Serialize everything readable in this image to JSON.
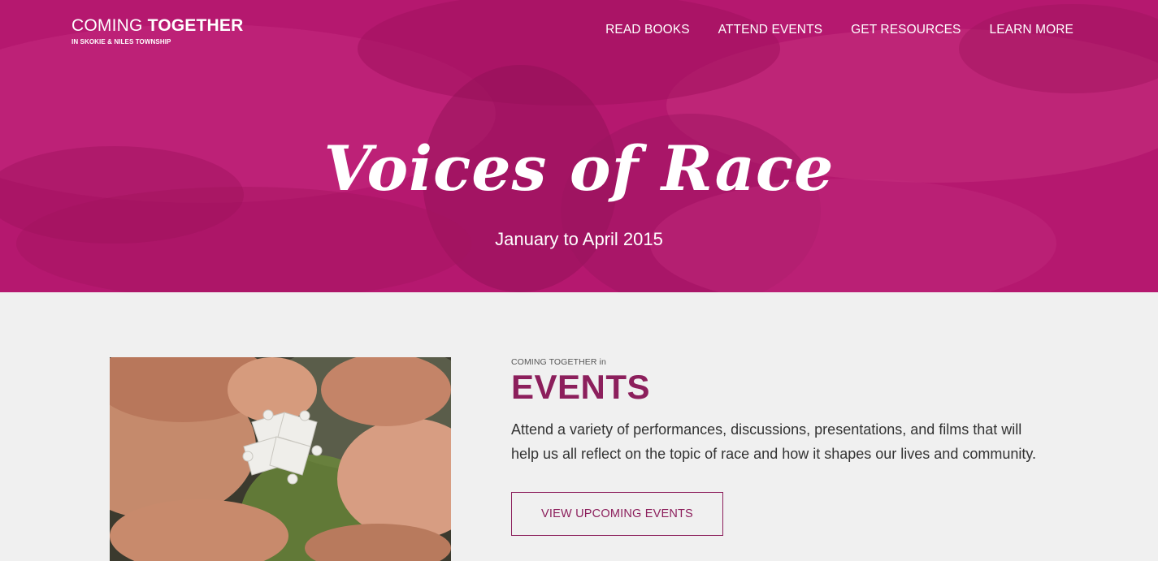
{
  "brand": {
    "title_light": "COMING ",
    "title_bold": "TOGETHER",
    "subtitle": "IN SKOKIE & NILES TOWNSHIP"
  },
  "nav": {
    "items": [
      {
        "label": "READ BOOKS"
      },
      {
        "label": "ATTEND EVENTS"
      },
      {
        "label": "GET RESOURCES"
      },
      {
        "label": "LEARN MORE"
      }
    ]
  },
  "hero": {
    "title": "Voices of Race",
    "subtitle": "January to April 2015"
  },
  "events_section": {
    "eyebrow": "COMING TOGETHER in",
    "title": "EVENTS",
    "description": "Attend a variety of performances, discussions, presentations, and films that will help us all reflect on the topic of race and how it shapes our lives and community.",
    "cta_label": "VIEW UPCOMING EVENTS"
  },
  "colors": {
    "hero_magenta": "#b5186f",
    "accent_plum": "#8c1f5c",
    "section_bg": "#f0f0f0"
  }
}
